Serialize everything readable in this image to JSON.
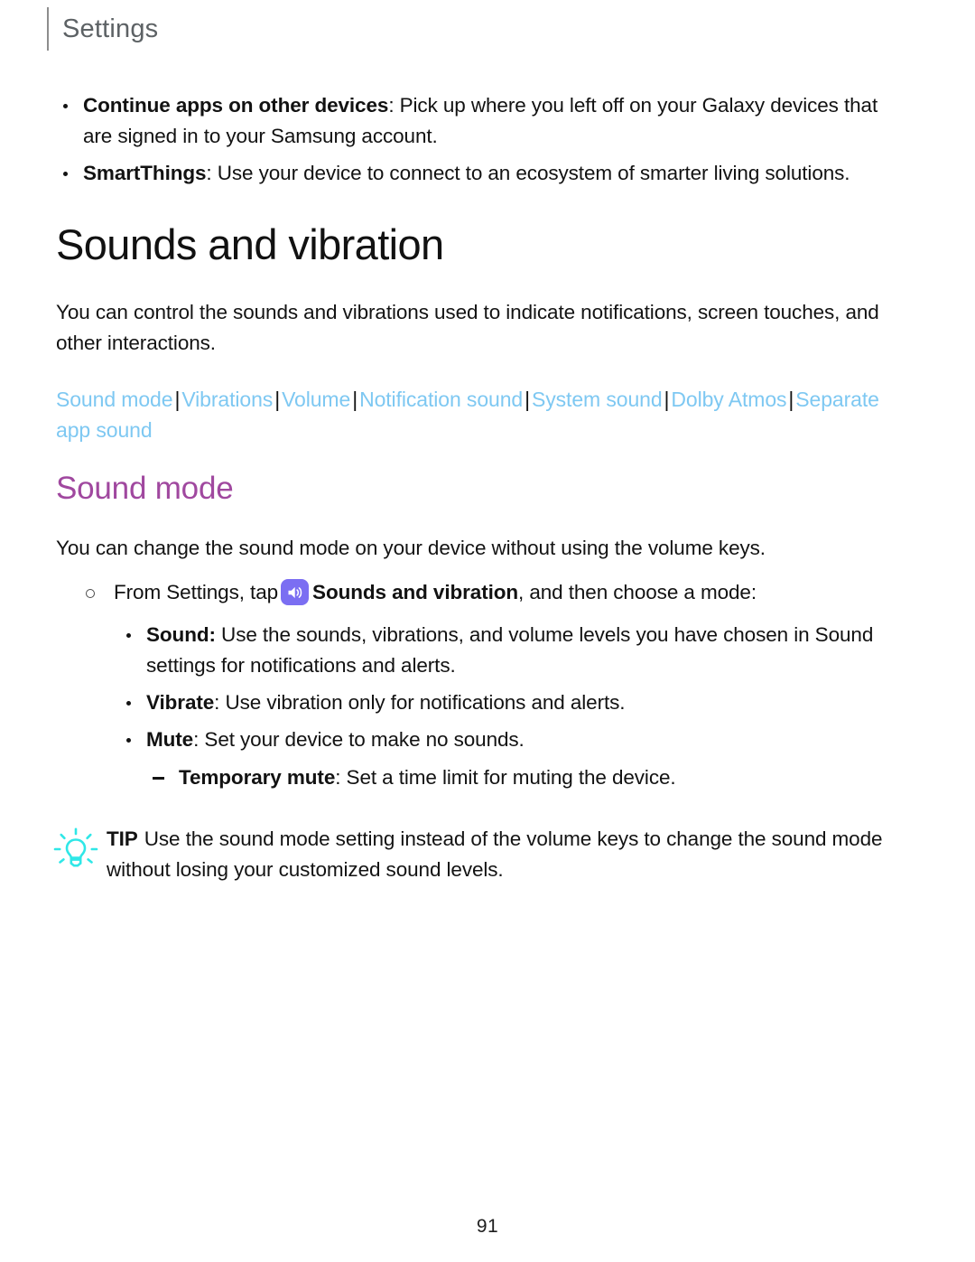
{
  "header": {
    "title": "Settings"
  },
  "continued_bullets": [
    {
      "term": "Continue apps on other devices",
      "colon_bold": false,
      "desc": "Pick up where you left off on your Galaxy devices that are signed in to your Samsung account."
    },
    {
      "term": "SmartThings",
      "colon_bold": false,
      "desc": "Use your device to connect to an ecosystem of smarter living solutions."
    }
  ],
  "section": {
    "heading": "Sounds and vibration",
    "intro": "You can control the sounds and vibrations used to indicate notifications, screen touches, and other interactions."
  },
  "linkbar": {
    "separator": "|",
    "links": [
      "Sound mode",
      "Vibrations",
      "Volume",
      "Notification sound",
      "System sound",
      "Dolby Atmos",
      "Separate app sound"
    ],
    "link_color": "#7ec8f2"
  },
  "subsection": {
    "heading": "Sound mode",
    "heading_color": "#a0489f",
    "intro": "You can change the sound mode on your device without using the volume keys."
  },
  "step": {
    "prefix": "From Settings, tap",
    "icon_name": "sounds-and-vibration-icon",
    "icon_color": "#7b6ef2",
    "bold_label": "Sounds and vibration",
    "suffix": ", and then choose a mode:"
  },
  "mode_bullets": [
    {
      "term": "Sound:",
      "desc": "Use the sounds, vibrations, and volume levels you have chosen in Sound settings for notifications and alerts."
    },
    {
      "term": "Vibrate",
      "desc": "Use vibration only for notifications and alerts."
    },
    {
      "term": "Mute",
      "desc": "Set your device to make no sounds."
    }
  ],
  "sub_bullet": {
    "term": "Temporary mute",
    "desc": "Set a time limit for muting the device."
  },
  "tip": {
    "label": "TIP",
    "icon_name": "lightbulb-icon",
    "icon_color": "#2fe7e7",
    "text": "Use the sound mode setting instead of the volume keys to change the sound mode without losing your customized sound levels."
  },
  "footer": {
    "page_number": "91"
  }
}
